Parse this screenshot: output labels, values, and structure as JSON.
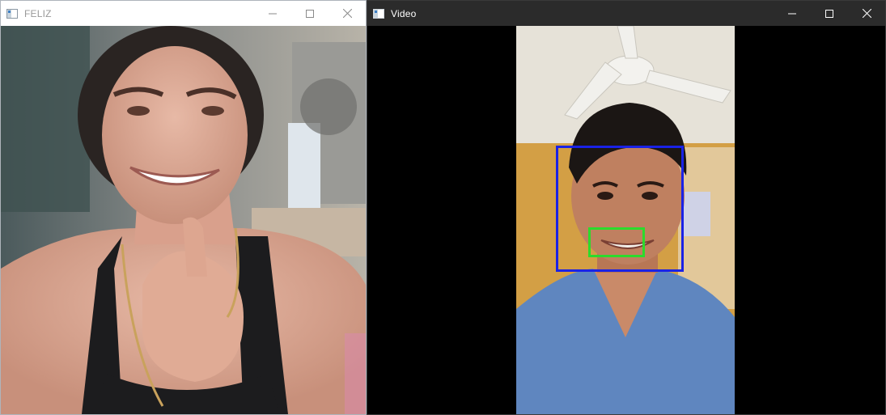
{
  "windows": [
    {
      "title": "FELIZ",
      "controls": [
        "minimize-icon",
        "maximize-icon",
        "close-icon"
      ]
    },
    {
      "title": "Video",
      "controls": [
        "minimize-icon",
        "maximize-icon",
        "close-icon"
      ]
    }
  ],
  "colors": {
    "face_box": "#1a22e6",
    "mouth_box": "#2cdb2c",
    "video_titlebar": "#2b2b2b",
    "feliz_titlebar": "#ffffff"
  }
}
